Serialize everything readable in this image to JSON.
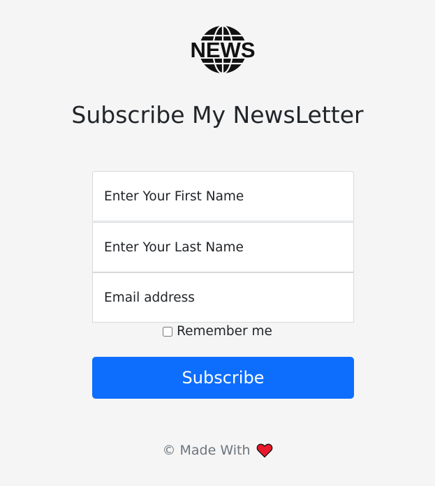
{
  "logo": {
    "text": "NEWS",
    "icon": "globe-news-icon"
  },
  "title": "Subscribe My NewsLetter",
  "form": {
    "first_name_placeholder": "Enter Your First Name",
    "last_name_placeholder": "Enter Your Last Name",
    "email_placeholder": "Email address",
    "remember_label": "Remember me",
    "remember_checked": false,
    "submit_label": "Subscribe"
  },
  "footer": {
    "text": "© Made With",
    "icon": "heart-icon"
  },
  "colors": {
    "background": "#f5f5f5",
    "primary": "#0d6efd",
    "heart": "#e8192c",
    "text": "#212529",
    "muted": "#6c757d"
  }
}
